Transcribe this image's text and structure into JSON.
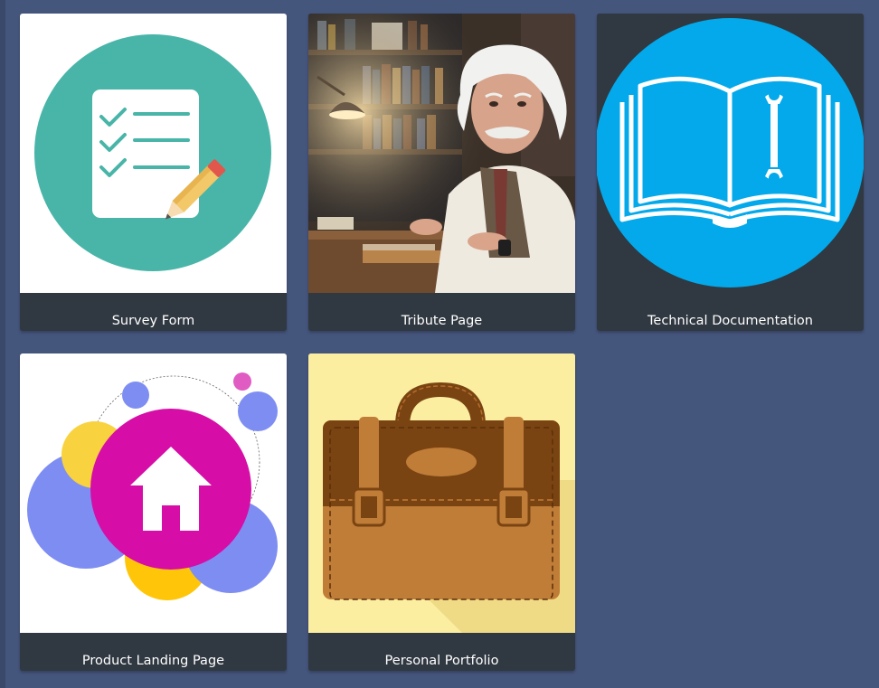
{
  "projects": [
    {
      "title": "Survey Form",
      "image_icon": "survey-checklist-pencil-icon"
    },
    {
      "title": "Tribute Page",
      "image_icon": "portrait-photo"
    },
    {
      "title": "Technical Documentation",
      "image_icon": "book-wrench-icon"
    },
    {
      "title": "Product Landing Page",
      "image_icon": "house-bubbles-icon"
    },
    {
      "title": "Personal Portfolio",
      "image_icon": "briefcase-icon"
    }
  ],
  "colors": {
    "page_background": "#45567d",
    "card_background": "#303841",
    "title_text": "#ffffff",
    "survey_circle": "#48b5a8",
    "docs_circle": "#03a9ea",
    "landing_circle": "#d60da6",
    "portfolio_background": "#fbeea1",
    "briefcase_brown": "#c07d38"
  }
}
